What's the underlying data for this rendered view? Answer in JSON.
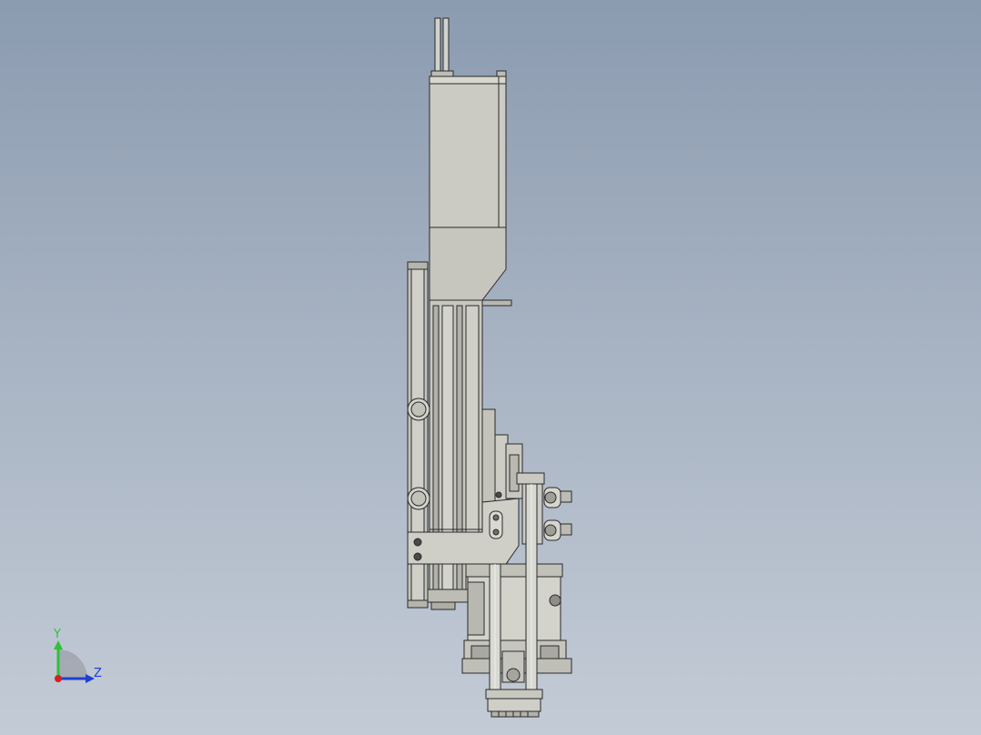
{
  "viewport": {
    "background_top": "#8b9bb0",
    "background_bottom": "#c3cbd6"
  },
  "model": {
    "part_fill": "#c9c9c1",
    "part_fill_light": "#d6d6cf",
    "part_fill_dark": "#a9a9a2",
    "edge_color": "#2a2a2a"
  },
  "triad": {
    "y_label": "Y",
    "z_label": "Z",
    "y_color": "#2cc23a",
    "z_color": "#1f3fd0",
    "x_color": "#d42020"
  }
}
